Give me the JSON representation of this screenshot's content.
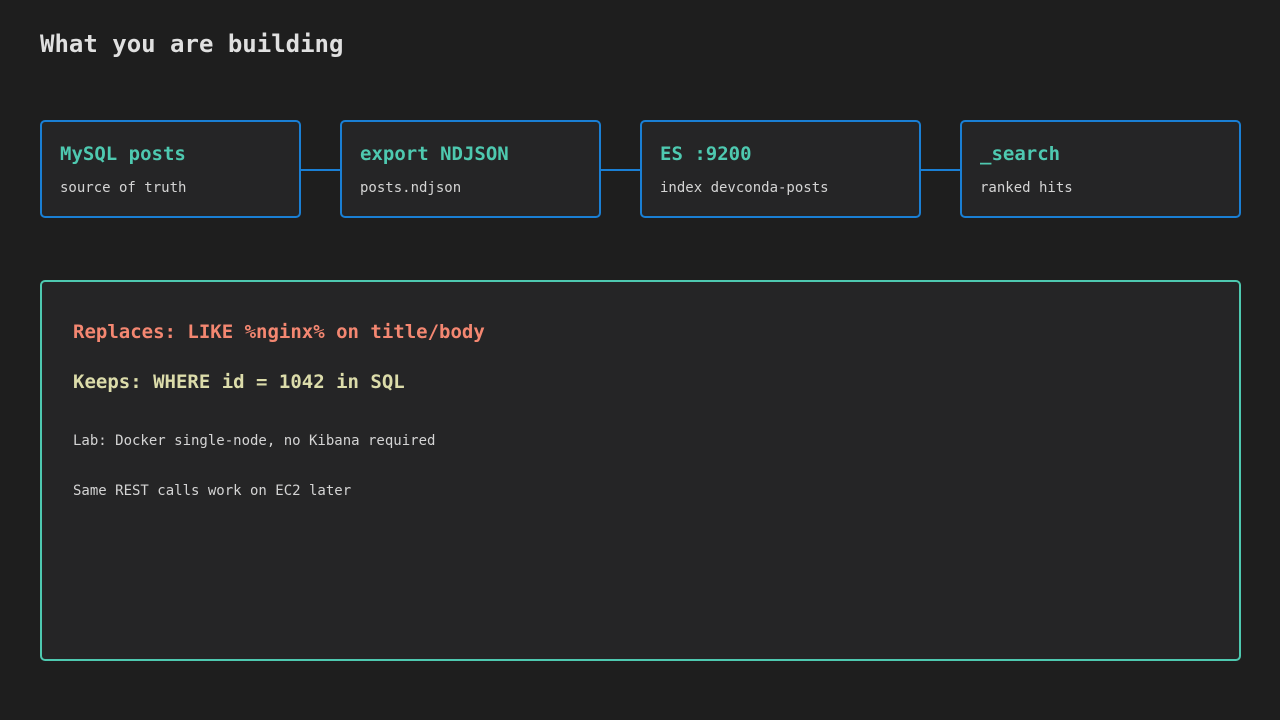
{
  "title": "What you are building",
  "pipeline": {
    "nodes": [
      {
        "title": "MySQL posts",
        "subtitle": "source of truth"
      },
      {
        "title": "export NDJSON",
        "subtitle": "posts.ndjson"
      },
      {
        "title": "ES :9200",
        "subtitle": "index devconda-posts"
      },
      {
        "title": "_search",
        "subtitle": "ranked hits"
      }
    ]
  },
  "panel": {
    "replaces": "Replaces: LIKE %nginx% on title/body",
    "keeps": "Keeps: WHERE id = 1042 in SQL",
    "notes": [
      "Lab: Docker single-node, no Kibana required",
      "Same REST calls work on EC2 later"
    ]
  },
  "colors": {
    "background": "#1e1e1e",
    "node_border": "#1a7fd4",
    "node_title": "#4ec9b0",
    "panel_border": "#4ec9b0",
    "replaces_text": "#f48771",
    "keeps_text": "#dcdcaa"
  }
}
